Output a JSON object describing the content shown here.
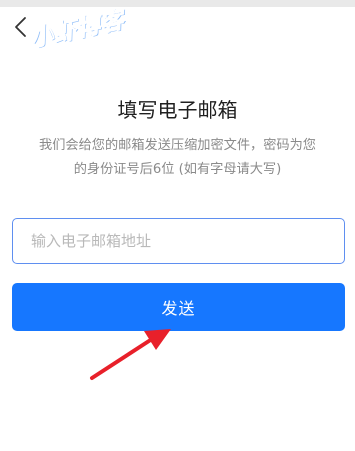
{
  "watermark": {
    "text": "小虾博客"
  },
  "header": {
    "back_icon": "chevron-left-icon"
  },
  "main": {
    "title": "填写电子邮箱",
    "description_line1": "我们会给您的邮箱发送压缩加密文件，密码为您",
    "description_line2": "的身份证号后6位 (如有字母请大写)",
    "email_placeholder": "输入电子邮箱地址",
    "send_label": "发送"
  },
  "colors": {
    "primary": "#1677ff",
    "input_border": "#5f8ff0",
    "annotation_arrow": "#e8202a",
    "watermark": "#2f86f4"
  }
}
